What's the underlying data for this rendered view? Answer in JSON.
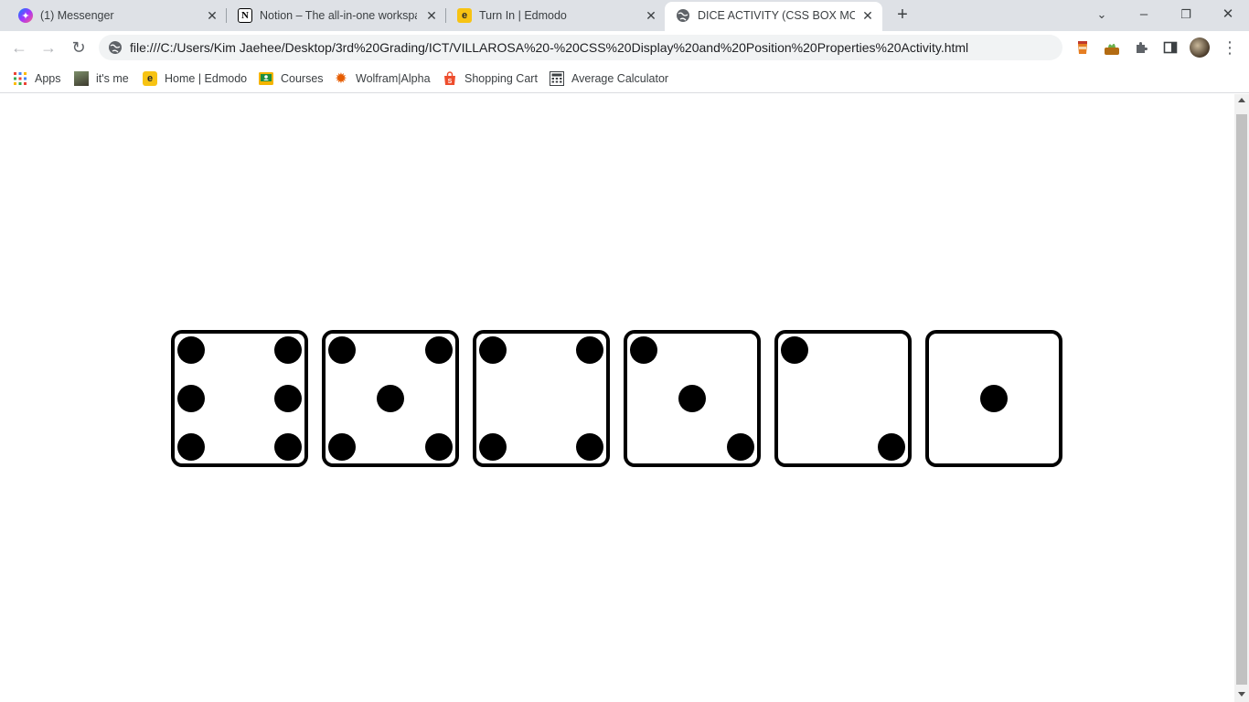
{
  "tabs": [
    {
      "title": "(1) Messenger",
      "icon": "messenger-icon",
      "active": false
    },
    {
      "title": "Notion – The all-in-one workspace",
      "icon": "notion-icon",
      "active": false
    },
    {
      "title": "Turn In | Edmodo",
      "icon": "edmodo-icon",
      "active": false
    },
    {
      "title": "DICE ACTIVITY (CSS BOX MODEL",
      "icon": "globe-icon",
      "active": true
    }
  ],
  "toolbar": {
    "url": "file:///C:/Users/Kim Jaehee/Desktop/3rd%20Grading/ICT/VILLAROSA%20-%20CSS%20Display%20and%20Position%20Properties%20Activity.html"
  },
  "bookmarks": [
    {
      "label": "Apps",
      "icon": "apps-grid-icon"
    },
    {
      "label": "it's me",
      "icon": "photo-icon"
    },
    {
      "label": "Home | Edmodo",
      "icon": "edmodo-icon"
    },
    {
      "label": "Courses",
      "icon": "classroom-icon"
    },
    {
      "label": "Wolfram|Alpha",
      "icon": "wolfram-icon"
    },
    {
      "label": "Shopping Cart",
      "icon": "shopee-icon"
    },
    {
      "label": "Average Calculator",
      "icon": "calculator-icon"
    }
  ],
  "dice": [
    {
      "value": 6
    },
    {
      "value": 5
    },
    {
      "value": 4
    },
    {
      "value": 3
    },
    {
      "value": 2
    },
    {
      "value": 1
    }
  ],
  "colors": {
    "tabstrip": "#dee1e6",
    "omnibox": "#f1f3f4",
    "pip": "#000000",
    "die_border": "#000000"
  }
}
